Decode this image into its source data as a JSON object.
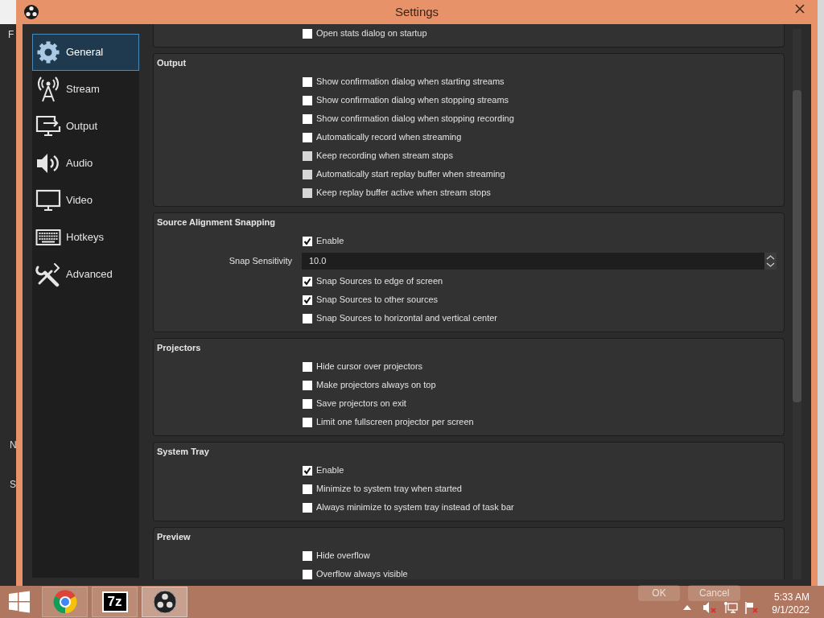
{
  "background_window": {
    "texts": [
      "F",
      "N",
      "S"
    ]
  },
  "window": {
    "title": "Settings"
  },
  "sidebar": {
    "items": [
      {
        "label": "General",
        "kind": "gear",
        "selected": true
      },
      {
        "label": "Stream",
        "kind": "antenna",
        "selected": false
      },
      {
        "label": "Output",
        "kind": "export",
        "selected": false
      },
      {
        "label": "Audio",
        "kind": "speaker",
        "selected": false
      },
      {
        "label": "Video",
        "kind": "monitor",
        "selected": false
      },
      {
        "label": "Hotkeys",
        "kind": "keyboard",
        "selected": false
      },
      {
        "label": "Advanced",
        "kind": "tools",
        "selected": false
      }
    ]
  },
  "sections": [
    {
      "rows": [
        {
          "kind": "checkbox",
          "label": "Open stats dialog on startup",
          "checked": false,
          "disabled": false
        }
      ]
    },
    {
      "title": "Output",
      "rows": [
        {
          "kind": "checkbox",
          "label": "Show confirmation dialog when starting streams",
          "checked": false,
          "disabled": false
        },
        {
          "kind": "checkbox",
          "label": "Show confirmation dialog when stopping streams",
          "checked": false,
          "disabled": false
        },
        {
          "kind": "checkbox",
          "label": "Show confirmation dialog when stopping recording",
          "checked": false,
          "disabled": false
        },
        {
          "kind": "checkbox",
          "label": "Automatically record when streaming",
          "checked": false,
          "disabled": false
        },
        {
          "kind": "checkbox",
          "label": "Keep recording when stream stops",
          "checked": false,
          "disabled": true
        },
        {
          "kind": "checkbox",
          "label": "Automatically start replay buffer when streaming",
          "checked": false,
          "disabled": true
        },
        {
          "kind": "checkbox",
          "label": "Keep replay buffer active when stream stops",
          "checked": false,
          "disabled": true
        }
      ]
    },
    {
      "title": "Source Alignment Snapping",
      "rows": [
        {
          "kind": "checkbox",
          "label": "Enable",
          "checked": true,
          "disabled": false
        },
        {
          "kind": "spinbox",
          "label": "Snap Sensitivity",
          "value": "10.0"
        },
        {
          "kind": "checkbox",
          "label": "Snap Sources to edge of screen",
          "checked": true,
          "disabled": false
        },
        {
          "kind": "checkbox",
          "label": "Snap Sources to other sources",
          "checked": true,
          "disabled": false
        },
        {
          "kind": "checkbox",
          "label": "Snap Sources to horizontal and vertical center",
          "checked": false,
          "disabled": false
        }
      ]
    },
    {
      "title": "Projectors",
      "rows": [
        {
          "kind": "checkbox",
          "label": "Hide cursor over projectors",
          "checked": false,
          "disabled": false
        },
        {
          "kind": "checkbox",
          "label": "Make projectors always on top",
          "checked": false,
          "disabled": false
        },
        {
          "kind": "checkbox",
          "label": "Save projectors on exit",
          "checked": false,
          "disabled": false
        },
        {
          "kind": "checkbox",
          "label": "Limit one fullscreen projector per screen",
          "checked": false,
          "disabled": false
        }
      ]
    },
    {
      "title": "System Tray",
      "rows": [
        {
          "kind": "checkbox",
          "label": "Enable",
          "checked": true,
          "disabled": false
        },
        {
          "kind": "checkbox",
          "label": "Minimize to system tray when started",
          "checked": false,
          "disabled": false
        },
        {
          "kind": "checkbox",
          "label": "Always minimize to system tray instead of task bar",
          "checked": false,
          "disabled": false
        }
      ]
    },
    {
      "title": "Preview",
      "rows": [
        {
          "kind": "checkbox",
          "label": "Hide overflow",
          "checked": false,
          "disabled": false
        },
        {
          "kind": "checkbox",
          "label": "Overflow always visible",
          "checked": false,
          "disabled": false
        }
      ]
    }
  ],
  "dialog_buttons": [
    {
      "label": "OK"
    },
    {
      "label": "Cancel"
    }
  ],
  "taskbar": {
    "apps": [
      {
        "kind": "chrome",
        "active": false
      },
      {
        "kind": "archiver",
        "text": "7z",
        "active": false
      },
      {
        "kind": "obs",
        "active": true
      }
    ],
    "clock": {
      "time": "5:33 AM",
      "date": "9/1/2022"
    }
  }
}
